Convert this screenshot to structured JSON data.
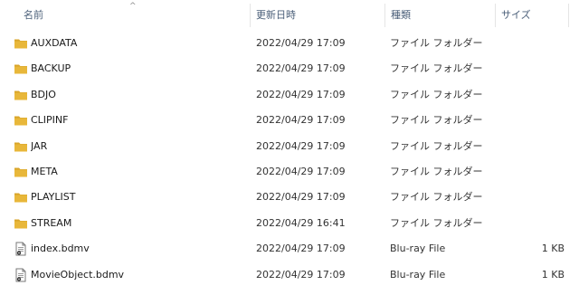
{
  "columns": {
    "name": "名前",
    "date": "更新日時",
    "type": "種類",
    "size": "サイズ"
  },
  "sort_indicator": "^",
  "rows": [
    {
      "name": "AUXDATA",
      "date": "2022/04/29 17:09",
      "type": "ファイル フォルダー",
      "size": "",
      "icon": "folder-icon"
    },
    {
      "name": "BACKUP",
      "date": "2022/04/29 17:09",
      "type": "ファイル フォルダー",
      "size": "",
      "icon": "folder-icon"
    },
    {
      "name": "BDJO",
      "date": "2022/04/29 17:09",
      "type": "ファイル フォルダー",
      "size": "",
      "icon": "folder-icon"
    },
    {
      "name": "CLIPINF",
      "date": "2022/04/29 17:09",
      "type": "ファイル フォルダー",
      "size": "",
      "icon": "folder-icon"
    },
    {
      "name": "JAR",
      "date": "2022/04/29 17:09",
      "type": "ファイル フォルダー",
      "size": "",
      "icon": "folder-icon"
    },
    {
      "name": "META",
      "date": "2022/04/29 17:09",
      "type": "ファイル フォルダー",
      "size": "",
      "icon": "folder-icon"
    },
    {
      "name": "PLAYLIST",
      "date": "2022/04/29 17:09",
      "type": "ファイル フォルダー",
      "size": "",
      "icon": "folder-icon"
    },
    {
      "name": "STREAM",
      "date": "2022/04/29 16:41",
      "type": "ファイル フォルダー",
      "size": "",
      "icon": "folder-icon"
    },
    {
      "name": "index.bdmv",
      "date": "2022/04/29 17:09",
      "type": "Blu-ray File",
      "size": "1 KB",
      "icon": "file-icon"
    },
    {
      "name": "MovieObject.bdmv",
      "date": "2022/04/29 17:09",
      "type": "Blu-ray File",
      "size": "1 KB",
      "icon": "file-icon"
    }
  ],
  "colors": {
    "folder": "#e8b73a",
    "folder_dark": "#d9a52a",
    "header_text": "#4c607a"
  }
}
